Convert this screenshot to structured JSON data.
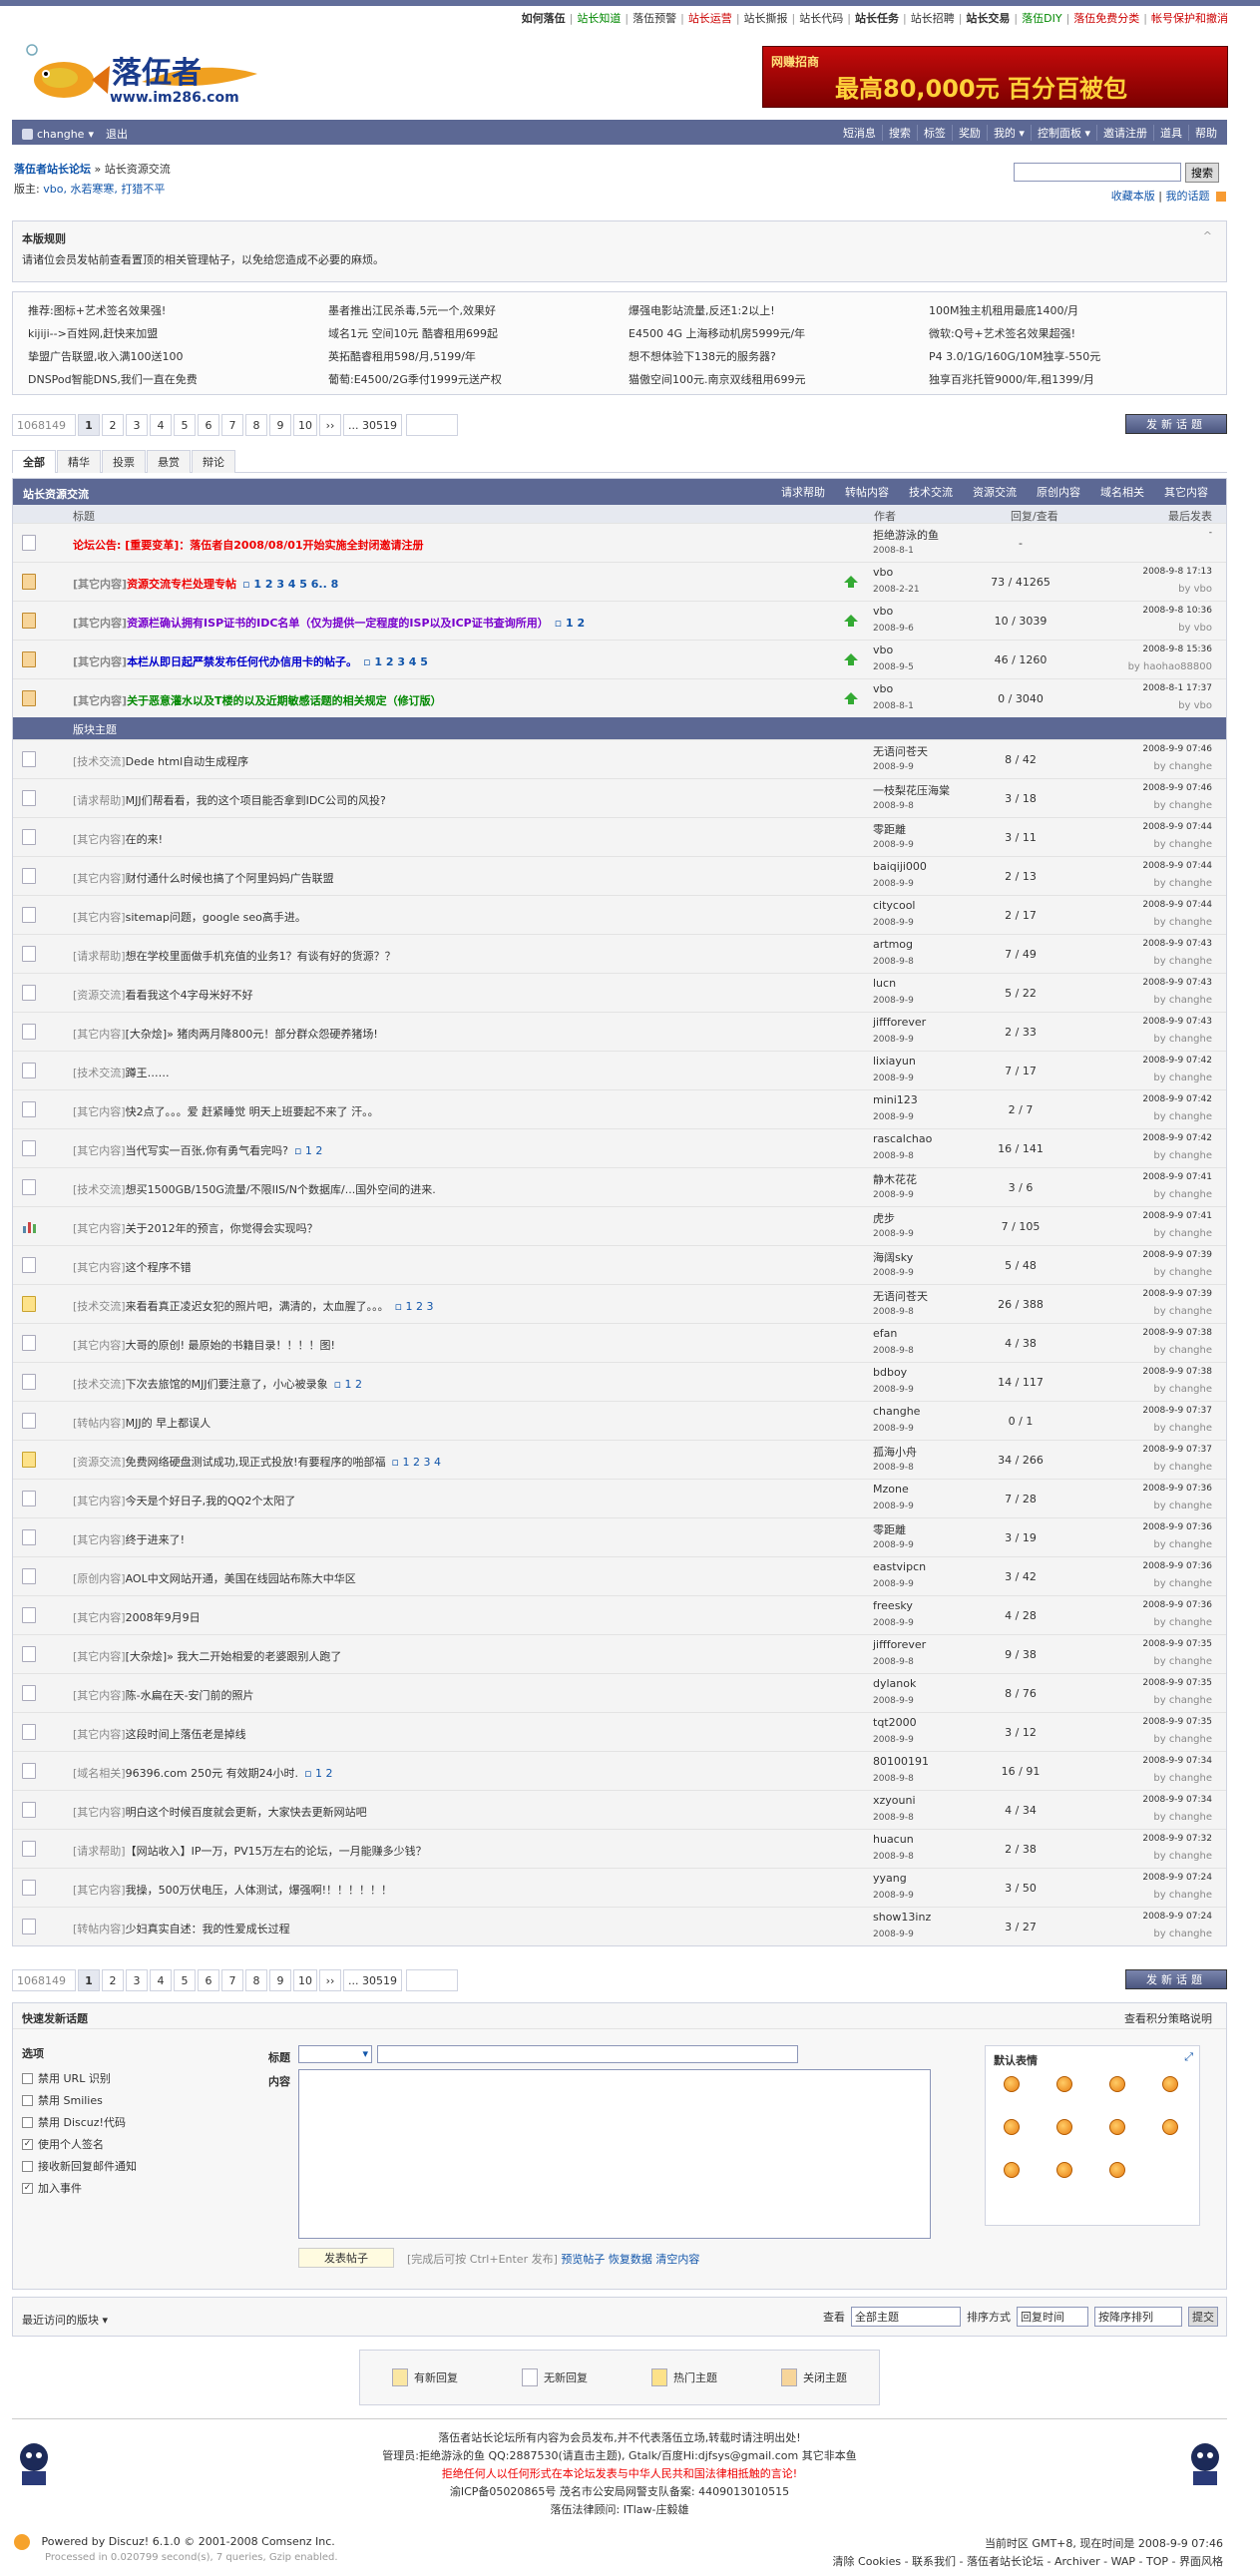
{
  "top_links": [
    "如何落伍",
    "站长知道",
    "落伍预警",
    "站长运营",
    "站长撕报",
    "站长代码",
    "站长任务",
    "站长招聘",
    "站长交易",
    "落伍DIY",
    "落伍免费分类",
    "帐号保护和撤消"
  ],
  "logo": {
    "name": "落伍者",
    "url": "www.im286.com"
  },
  "banner": {
    "small": "网赚招商",
    "big": "最高80,000元 百分百被包"
  },
  "nav": {
    "user": "changhe",
    "logout": "退出",
    "items": [
      "短消息",
      "搜索",
      "标签",
      "奖励",
      "我的",
      "控制面板",
      "邀请注册",
      "道具",
      "帮助"
    ]
  },
  "breadcrumb": {
    "forum": "落伍者站长论坛",
    "sep": "»",
    "current": "站长资源交流"
  },
  "moderators": {
    "label": "版主:",
    "names": "vbo, 水若寒寒, 打猎不平"
  },
  "search": {
    "button": "搜索",
    "placeholder": ""
  },
  "favs": {
    "fav": "收藏本版",
    "topics": "我的话题"
  },
  "rules": {
    "title": "本版规则",
    "text": "请诸位会员发帖前查看置顶的相关管理帖子，以免给您造成不必要的麻烦。",
    "toggle": "^"
  },
  "ads": [
    [
      "推荐:图标+艺术签名效果强!",
      "墨者推出江民杀毒,5元一个,效果好",
      "爆强电影站流量,反还1:2以上!",
      "100M独主机租用最底1400/月"
    ],
    [
      "kijiji-->百姓网,赶快来加盟",
      "域名1元 空间10元 酷睿租用699起",
      "E4500 4G 上海移动机房5999元/年",
      "微软:Q号+艺术签名效果超强!"
    ],
    [
      "挚盟广告联盟,收入满100送100",
      "英拓酷睿租用598/月,5199/年",
      "想不想体验下138元的服务器?",
      "P4 3.0/1G/160G/10M独享-550元"
    ],
    [
      "DNSPod智能DNS,我们一直在免费",
      "葡萄:E4500/2G季付1999元送产权",
      "猫傲空间100元.南京双线租用699元",
      "独享百兆托管9000/年,租1399/月"
    ]
  ],
  "pager": {
    "total": "1068149",
    "pages": [
      "1",
      "2",
      "3",
      "4",
      "5",
      "6",
      "7",
      "8",
      "9",
      "10",
      "››",
      "... 30519"
    ],
    "newpost": "发新话题"
  },
  "tabs": [
    "全部",
    "精华",
    "投票",
    "悬赏",
    "辩论"
  ],
  "table": {
    "name": "站长资源交流",
    "types": [
      "请求帮助",
      "转帖内容",
      "技术交流",
      "资源交流",
      "原创内容",
      "域名相关",
      "其它内容"
    ],
    "cols": {
      "title": "标题",
      "author": "作者",
      "replies": "回复/查看",
      "last": "最后发表"
    },
    "section": "版块主题"
  },
  "pinned": [
    {
      "icon": "plain",
      "type": "",
      "title": "论坛公告: [重要变革]：落伍者自2008/08/01开始实施全封闭邀请注册",
      "pages": "",
      "author": "拒绝游泳的鱼",
      "date": "2008-8-1",
      "cnt": "-",
      "ldate": "-",
      "lby": "",
      "red": true
    },
    {
      "icon": "lock",
      "type": "[其它内容]",
      "title": "资源交流专栏处理专帖",
      "pages": "1 2 3 4 5 6.. 8",
      "author": "vbo",
      "date": "2008-2-21",
      "cnt": "73 / 41265",
      "ldate": "2008-9-8 17:13",
      "lby": "vbo",
      "red": true
    },
    {
      "icon": "lock",
      "type": "[其它内容]",
      "title": "资源栏确认拥有ISP证书的IDC名单（仅为提供一定程度的ISP以及ICP证书查询所用）",
      "pages": "1 2",
      "author": "vbo",
      "date": "2008-9-6",
      "cnt": "10 / 3039",
      "ldate": "2008-9-8 10:36",
      "lby": "vbo",
      "purple": true
    },
    {
      "icon": "lock",
      "type": "[其它内容]",
      "title": "本栏从即日起严禁发布任何代办信用卡的帖子。",
      "pages": "1 2 3 4 5",
      "author": "vbo",
      "date": "2008-9-5",
      "cnt": "46 / 1260",
      "ldate": "2008-9-8 15:36",
      "lby": "haohao88800",
      "blue": true
    },
    {
      "icon": "lock",
      "type": "[其它内容]",
      "title": "关于恶意灌水以及T楼的以及近期敏感话题的相关规定（修订版）",
      "pages": "",
      "author": "vbo",
      "date": "2008-8-1",
      "cnt": "0 / 3040",
      "ldate": "2008-8-1 17:37",
      "lby": "vbo",
      "green": true
    }
  ],
  "threads": [
    {
      "icon": "plain",
      "type": "[技术交流]",
      "title": "Dede html自动生成程序",
      "pages": "",
      "author": "无语问苍天",
      "date": "2008-9-9",
      "cnt": "8 / 42",
      "ldate": "2008-9-9 07:46",
      "lby": "changhe"
    },
    {
      "icon": "plain",
      "type": "[请求帮助]",
      "title": "MJJ们帮看看，我的这个项目能否拿到IDC公司的风投?",
      "pages": "",
      "author": "一枝梨花压海棠",
      "date": "2008-9-8",
      "cnt": "3 / 18",
      "ldate": "2008-9-9 07:46",
      "lby": "changhe"
    },
    {
      "icon": "plain",
      "type": "[其它内容]",
      "title": "在的来!",
      "pages": "",
      "author": "零距離",
      "date": "2008-9-9",
      "cnt": "3 / 11",
      "ldate": "2008-9-9 07:44",
      "lby": "changhe"
    },
    {
      "icon": "plain",
      "type": "[其它内容]",
      "title": "财付通什么时候也搞了个阿里妈妈广告联盟",
      "pages": "",
      "author": "baiqiji000",
      "date": "2008-9-9",
      "cnt": "2 / 13",
      "ldate": "2008-9-9 07:44",
      "lby": "changhe"
    },
    {
      "icon": "plain",
      "type": "[其它内容]",
      "title": "sitemap问题，google seo高手进。",
      "pages": "",
      "author": "citycool",
      "date": "2008-9-9",
      "cnt": "2 / 17",
      "ldate": "2008-9-9 07:44",
      "lby": "changhe"
    },
    {
      "icon": "plain",
      "type": "[请求帮助]",
      "title": "想在学校里面做手机充值的业务1？有谈有好的货源？？",
      "pages": "",
      "author": "artmog",
      "date": "2008-9-8",
      "cnt": "7 / 49",
      "ldate": "2008-9-9 07:43",
      "lby": "changhe"
    },
    {
      "icon": "plain",
      "type": "[资源交流]",
      "title": "看看我这个4字母米好不好",
      "pages": "",
      "author": "lucn",
      "date": "2008-9-9",
      "cnt": "5 / 22",
      "ldate": "2008-9-9 07:43",
      "lby": "changhe"
    },
    {
      "icon": "plain",
      "type": "[其它内容]",
      "title": "[大杂烩]» 猪肉两月降800元！部分群众怨硬养猪场!",
      "pages": "",
      "author": "jiffforever",
      "date": "2008-9-9",
      "cnt": "2 / 33",
      "ldate": "2008-9-9 07:43",
      "lby": "changhe"
    },
    {
      "icon": "plain",
      "type": "[技术交流]",
      "title": "蹲王……",
      "pages": "",
      "author": "lixiayun",
      "date": "2008-9-9",
      "cnt": "7 / 17",
      "ldate": "2008-9-9 07:42",
      "lby": "changhe"
    },
    {
      "icon": "plain",
      "type": "[其它内容]",
      "title": "快2点了。。。爱 赶紧睡觉 明天上班要起不来了 汗。。",
      "pages": "",
      "author": "mini123",
      "date": "2008-9-9",
      "cnt": "2 / 7",
      "ldate": "2008-9-9 07:42",
      "lby": "changhe"
    },
    {
      "icon": "plain",
      "type": "[其它内容]",
      "title": "当代写实一百张,你有勇气看完吗?",
      "pages": "1 2",
      "author": "rascalchao",
      "date": "2008-9-8",
      "cnt": "16 / 141",
      "ldate": "2008-9-9 07:42",
      "lby": "changhe"
    },
    {
      "icon": "plain",
      "type": "[技术交流]",
      "title": "想买1500GB/150G流量/不限IIS/N个数据库/...国外空间的进来.",
      "pages": "",
      "author": "静木花花",
      "date": "2008-9-9",
      "cnt": "3 / 6",
      "ldate": "2008-9-9 07:41",
      "lby": "changhe"
    },
    {
      "icon": "poll",
      "type": "[其它内容]",
      "title": "关于2012年的预言，你觉得会实现吗？",
      "pages": "",
      "author": "虎步",
      "date": "2008-9-9",
      "cnt": "7 / 105",
      "ldate": "2008-9-9 07:41",
      "lby": "changhe"
    },
    {
      "icon": "plain",
      "type": "[其它内容]",
      "title": "这个程序不错",
      "pages": "",
      "author": "海阔sky",
      "date": "2008-9-9",
      "cnt": "5 / 48",
      "ldate": "2008-9-9 07:39",
      "lby": "changhe"
    },
    {
      "icon": "hot",
      "type": "[技术交流]",
      "title": "来看看真正凌迟女犯的照片吧，满清的，太血腥了。。。",
      "pages": "1 2 3",
      "author": "无语问苍天",
      "date": "2008-9-8",
      "cnt": "26 / 388",
      "ldate": "2008-9-9 07:39",
      "lby": "changhe"
    },
    {
      "icon": "plain",
      "type": "[其它内容]",
      "title": "大哥的原创! 最原始的书籍目录！！！！图!",
      "pages": "",
      "author": "efan",
      "date": "2008-9-8",
      "cnt": "4 / 38",
      "ldate": "2008-9-9 07:38",
      "lby": "changhe"
    },
    {
      "icon": "plain",
      "type": "[技术交流]",
      "title": "下次去旅馆的MJJ们要注意了，小心被录象",
      "pages": "1 2",
      "author": "bdboy",
      "date": "2008-9-9",
      "cnt": "14 / 117",
      "ldate": "2008-9-9 07:38",
      "lby": "changhe"
    },
    {
      "icon": "plain",
      "type": "[转帖内容]",
      "title": "MJJ的 早上都误人",
      "pages": "",
      "author": "changhe",
      "date": "2008-9-9",
      "cnt": "0 / 1",
      "ldate": "2008-9-9 07:37",
      "lby": "changhe"
    },
    {
      "icon": "hot",
      "type": "[资源交流]",
      "title": "免费网络硬盘测试成功,现正式投放!有要程序的啪部福",
      "pages": "1 2 3 4",
      "author": "孤海小舟",
      "date": "2008-9-8",
      "cnt": "34 / 266",
      "ldate": "2008-9-9 07:37",
      "lby": "changhe"
    },
    {
      "icon": "plain",
      "type": "[其它内容]",
      "title": "今天是个好日子,我的QQ2个太阳了",
      "pages": "",
      "author": "Mzone",
      "date": "2008-9-9",
      "cnt": "7 / 28",
      "ldate": "2008-9-9 07:36",
      "lby": "changhe"
    },
    {
      "icon": "plain",
      "type": "[其它内容]",
      "title": "终于进来了!",
      "pages": "",
      "author": "零距離",
      "date": "2008-9-9",
      "cnt": "3 / 19",
      "ldate": "2008-9-9 07:36",
      "lby": "changhe"
    },
    {
      "icon": "plain",
      "type": "[原创内容]",
      "title": "AOL中文网站开通，美国在线园站布陈大中华区",
      "pages": "",
      "author": "eastvipcn",
      "date": "2008-9-9",
      "cnt": "3 / 42",
      "ldate": "2008-9-9 07:36",
      "lby": "changhe"
    },
    {
      "icon": "plain",
      "type": "[其它内容]",
      "title": "2008年9月9日",
      "pages": "",
      "author": "freesky",
      "date": "2008-9-9",
      "cnt": "4 / 28",
      "ldate": "2008-9-9 07:36",
      "lby": "changhe"
    },
    {
      "icon": "plain",
      "type": "[其它内容]",
      "title": "[大杂烩]» 我大二开始相爱的老婆跟别人跑了",
      "pages": "",
      "author": "jiffforever",
      "date": "2008-9-8",
      "cnt": "9 / 38",
      "ldate": "2008-9-9 07:35",
      "lby": "changhe"
    },
    {
      "icon": "plain",
      "type": "[其它内容]",
      "title": "陈-水扁在天-安门前的照片",
      "pages": "",
      "author": "dylanok",
      "date": "2008-9-9",
      "cnt": "8 / 76",
      "ldate": "2008-9-9 07:35",
      "lby": "changhe"
    },
    {
      "icon": "plain",
      "type": "[其它内容]",
      "title": "这段时间上落伍老是掉线",
      "pages": "",
      "author": "tqt2000",
      "date": "2008-9-9",
      "cnt": "3 / 12",
      "ldate": "2008-9-9 07:35",
      "lby": "changhe"
    },
    {
      "icon": "plain",
      "type": "[域名相关]",
      "title": "96396.com 250元 有效期24小时.",
      "pages": "1 2",
      "author": "80100191",
      "date": "2008-9-8",
      "cnt": "16 / 91",
      "ldate": "2008-9-9 07:34",
      "lby": "changhe"
    },
    {
      "icon": "plain",
      "type": "[其它内容]",
      "title": "明白这个时候百度就会更新，大家快去更新网站吧",
      "pages": "",
      "author": "xzyouni",
      "date": "2008-9-8",
      "cnt": "4 / 34",
      "ldate": "2008-9-9 07:34",
      "lby": "changhe"
    },
    {
      "icon": "plain",
      "type": "[请求帮助]",
      "title": "【网站收入】IP一万，PV15万左右的论坛，一月能赚多少钱？",
      "pages": "",
      "author": "huacun",
      "date": "2008-9-8",
      "cnt": "2 / 38",
      "ldate": "2008-9-9 07:32",
      "lby": "changhe"
    },
    {
      "icon": "plain",
      "type": "[其它内容]",
      "title": "我操，500万伏电压，人体测试，爆强啊!！！！！！！",
      "pages": "",
      "author": "yyang",
      "date": "2008-9-9",
      "cnt": "3 / 50",
      "ldate": "2008-9-9 07:24",
      "lby": "changhe"
    },
    {
      "icon": "plain",
      "type": "[转帖内容]",
      "title": "少妇真实自述：我的性爱成长过程",
      "pages": "",
      "author": "show13inz",
      "date": "2008-9-9",
      "cnt": "3 / 27",
      "ldate": "2008-9-9 07:24",
      "lby": "changhe"
    }
  ],
  "quickpost": {
    "title": "快速发新话题",
    "right": "查看积分策略说明",
    "opts_title": "选项",
    "opts": [
      [
        "禁用 URL 识别",
        false
      ],
      [
        "禁用 Smilies",
        false
      ],
      [
        "禁用 Discuz!代码",
        false
      ],
      [
        "使用个人签名",
        true
      ],
      [
        "接收新回复邮件通知",
        false
      ],
      [
        "加入事件",
        true
      ]
    ],
    "subject_label": "标题",
    "content_label": "内容",
    "submit": "发表帖子",
    "hint": "[完成后可按 Ctrl+Enter 发布]",
    "links": [
      "预览帖子",
      "恢复数据",
      "清空内容"
    ],
    "smilies_title": "默认表情"
  },
  "recent": {
    "label": "最近访问的版块",
    "view": "查看",
    "view_sel": "全部主题",
    "sort": "排序方式",
    "sort_sel": "回复时间",
    "order_sel": "按降序排列",
    "submit": "提交"
  },
  "legend": [
    "有新回复",
    "无新回复",
    "热门主题",
    "关闭主题"
  ],
  "footer": {
    "line1": "落伍者站长论坛所有内容为会员发布,并不代表落伍立场,转载时请注明出处!",
    "line2": "管理员:拒绝游泳的鱼 QQ:2887530(请直击主题), Gtalk/百度Hi:djfsys@gmail.com 其它非本鱼",
    "line3": "拒绝任何人以任何形式在本论坛发表与中华人民共和国法律相抵触的言论!",
    "line4": "渝ICP备05020865号   茂名市公安局网警支队备案: 4409013010515",
    "line5": "落伍法律顾问: ITlaw-庄毅雄",
    "powered": "Powered by Discuz! 6.1.0 © 2001-2008 Comsenz Inc.",
    "processed": "Processed in 0.020799 second(s), 7 queries, Gzip enabled.",
    "tz": "当前时区 GMT+8, 现在时间是 2008-9-9 07:46",
    "links": "清除 Cookies - 联系我们 - 落伍者站长论坛 - Archiver - WAP - TOP - 界面风格"
  }
}
